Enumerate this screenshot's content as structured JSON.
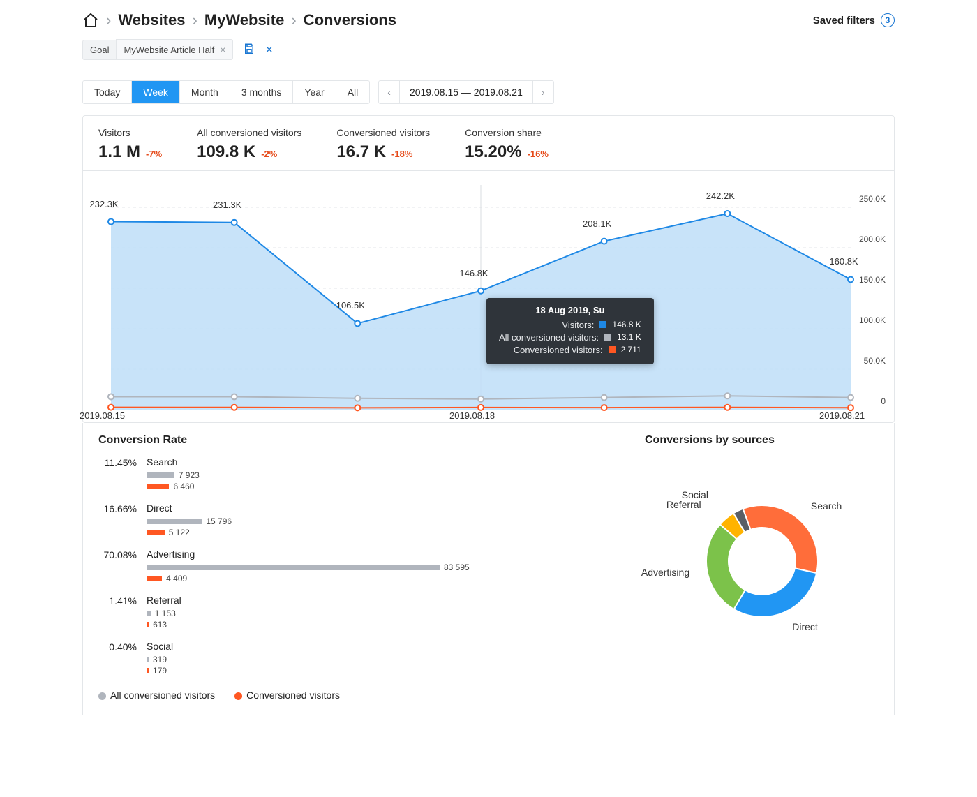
{
  "breadcrumb": [
    "Websites",
    "MyWebsite",
    "Conversions"
  ],
  "saved_filters": {
    "label": "Saved filters",
    "count": 3
  },
  "filter_chip": {
    "key": "Goal",
    "value": "MyWebsite Article Half"
  },
  "period_tabs": [
    "Today",
    "Week",
    "Month",
    "3 months",
    "Year",
    "All"
  ],
  "period_active": "Week",
  "date_range": "2019.08.15 — 2019.08.21",
  "metrics": [
    {
      "label": "Visitors",
      "value": "1.1 M",
      "delta": "-7%"
    },
    {
      "label": "All conversioned visitors",
      "value": "109.8 K",
      "delta": "-2%"
    },
    {
      "label": "Conversioned visitors",
      "value": "16.7 K",
      "delta": "-18%"
    },
    {
      "label": "Conversion share",
      "value": "15.20%",
      "delta": "-16%"
    }
  ],
  "chart_data": {
    "type": "line",
    "title": "",
    "x": [
      "2019.08.15",
      "2019.08.16",
      "2019.08.17",
      "2019.08.18",
      "2019.08.19",
      "2019.08.20",
      "2019.08.21"
    ],
    "x_ticks": [
      "2019.08.15",
      "2019.08.18",
      "2019.08.21"
    ],
    "ylim": [
      0,
      250000
    ],
    "y_ticks": [
      "0",
      "50.0K",
      "100.0K",
      "150.0K",
      "200.0K",
      "250.0K"
    ],
    "series": [
      {
        "name": "Visitors",
        "color": "#1e88e5",
        "fill": "#bedef8",
        "values": [
          232300,
          231300,
          106500,
          146800,
          208100,
          242200,
          160800
        ],
        "labels": [
          "232.3K",
          "231.3K",
          "106.5K",
          "146.8K",
          "208.1K",
          "242.2K",
          "160.8K"
        ]
      },
      {
        "name": "All conversioned visitors",
        "color": "#b0b5bd",
        "values": [
          16000,
          16000,
          14000,
          13100,
          15000,
          17000,
          15000
        ]
      },
      {
        "name": "Conversioned visitors",
        "color": "#ff5722",
        "values": [
          2900,
          2800,
          2300,
          2711,
          2500,
          2800,
          2400
        ]
      }
    ],
    "tooltip": {
      "title": "18 Aug 2019, Su",
      "rows": [
        {
          "label": "Visitors:",
          "color": "#1e88e5",
          "value": "146.8 K"
        },
        {
          "label": "All conversioned visitors:",
          "color": "#b0b5bd",
          "value": "13.1 K"
        },
        {
          "label": "Conversioned visitors:",
          "color": "#ff5722",
          "value": "2 711"
        }
      ]
    }
  },
  "conversion_rate": {
    "title": "Conversion Rate",
    "max": 83595,
    "rows": [
      {
        "pct": "11.45%",
        "name": "Search",
        "all": 7923,
        "all_label": "7 923",
        "conv": 6460,
        "conv_label": "6 460"
      },
      {
        "pct": "16.66%",
        "name": "Direct",
        "all": 15796,
        "all_label": "15 796",
        "conv": 5122,
        "conv_label": "5 122"
      },
      {
        "pct": "70.08%",
        "name": "Advertising",
        "all": 83595,
        "all_label": "83 595",
        "conv": 4409,
        "conv_label": "4 409"
      },
      {
        "pct": "1.41%",
        "name": "Referral",
        "all": 1153,
        "all_label": "1 153",
        "conv": 613,
        "conv_label": "613"
      },
      {
        "pct": "0.40%",
        "name": "Social",
        "all": 319,
        "all_label": "319",
        "conv": 179,
        "conv_label": "179"
      }
    ],
    "legend": [
      {
        "color": "#b0b5bd",
        "label": "All conversioned visitors"
      },
      {
        "color": "#ff5722",
        "label": "Conversioned visitors"
      }
    ]
  },
  "by_sources": {
    "title": "Conversions by sources",
    "type": "donut",
    "slices": [
      {
        "name": "Search",
        "color": "#ff6d3a",
        "value": 34
      },
      {
        "name": "Direct",
        "color": "#2196f3",
        "value": 30
      },
      {
        "name": "Advertising",
        "color": "#7cc24a",
        "value": 28
      },
      {
        "name": "Referral",
        "color": "#ffb300",
        "value": 5
      },
      {
        "name": "Social",
        "color": "#5a5f66",
        "value": 3
      }
    ]
  }
}
